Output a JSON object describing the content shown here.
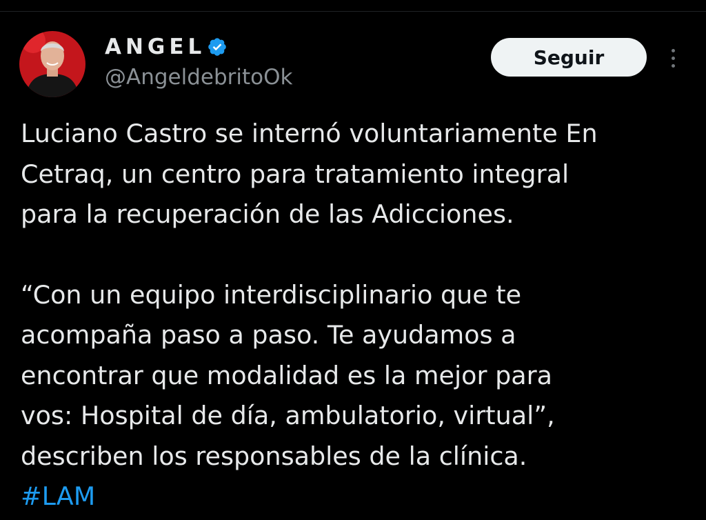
{
  "author": {
    "display_name": "ANGEL",
    "handle": "@AngeldebritoOk",
    "verified": true
  },
  "actions": {
    "follow_label": "Seguir"
  },
  "tweet": {
    "paragraph_1": "Luciano Castro se internó voluntariamente En\nCetraq, un centro para tratamiento integral\npara la recuperación de las Adicciones.",
    "paragraph_2": "“Con un equipo interdisciplinario que te\nacompaña paso a paso. Te ayudamos a\nencontrar que modalidad es la mejor para\nvos: Hospital de día, ambulatorio, virtual”,\ndescriben los responsables de la clínica.",
    "hashtag": "#LAM"
  },
  "icons": {
    "verified": "verified-badge-icon",
    "more": "more-options-icon"
  },
  "colors": {
    "background": "#000000",
    "text_primary": "#e7e9ea",
    "text_secondary": "#8b9196",
    "accent_link": "#1d9bf0",
    "verified_blue": "#1d9bf0",
    "follow_button_bg": "#eff3f4",
    "avatar_bg": "#c4161c"
  }
}
